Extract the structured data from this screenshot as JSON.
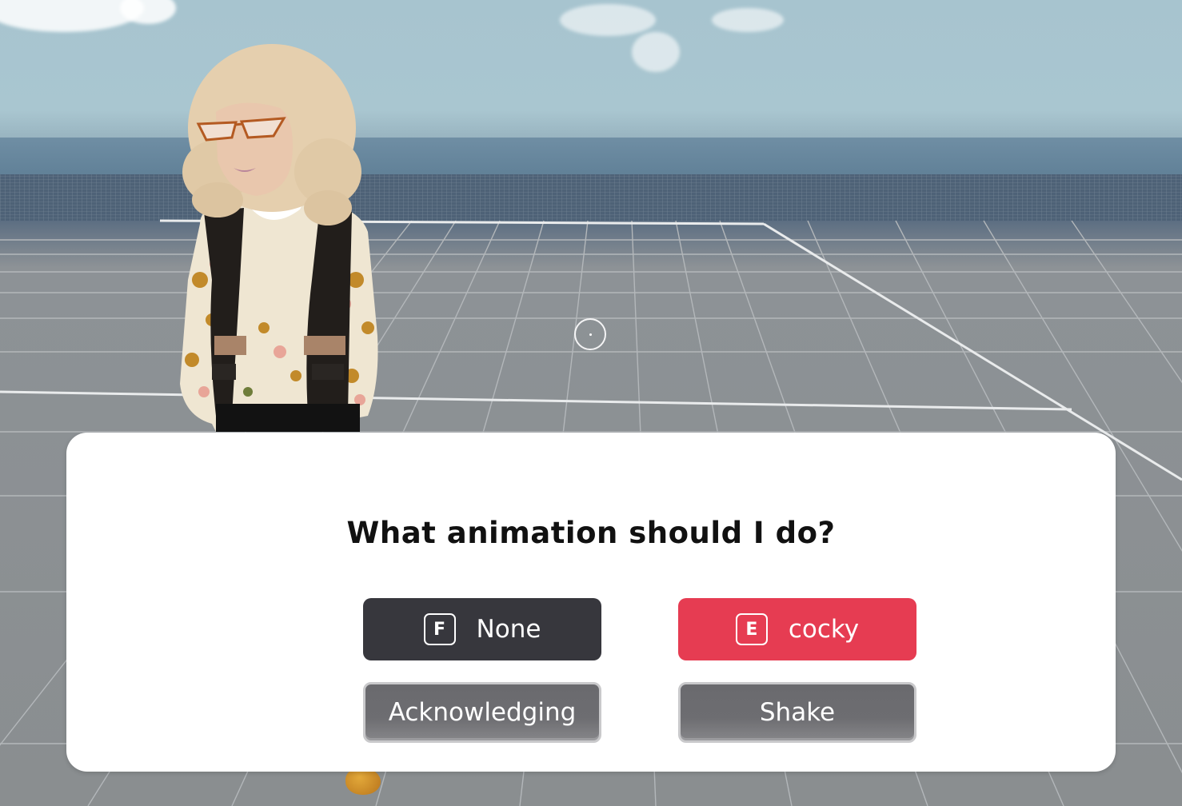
{
  "dialog": {
    "question": "What animation should I do?",
    "options": [
      {
        "key": "F",
        "label": "None",
        "state": "default"
      },
      {
        "key": "E",
        "label": "cocky",
        "state": "selected"
      },
      {
        "key": "",
        "label": "Acknowledging",
        "state": "default"
      },
      {
        "key": "",
        "label": "Shake",
        "state": "default"
      }
    ]
  },
  "colors": {
    "selected_option": "#e63c52",
    "keyed_option": "#37373d",
    "plain_option": "#6d6d71",
    "dialog_bg": "#ffffff"
  },
  "icons": {
    "crosshair": "crosshair-icon"
  }
}
